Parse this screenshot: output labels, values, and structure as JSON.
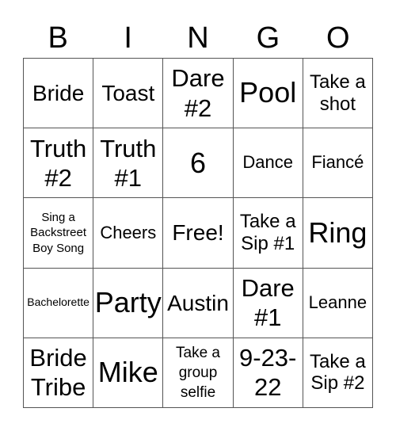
{
  "header": {
    "letters": [
      "B",
      "I",
      "N",
      "G",
      "O"
    ]
  },
  "grid": {
    "rows": [
      [
        "Bride",
        "Toast",
        "Dare #2",
        "Pool",
        "Take a shot"
      ],
      [
        "Truth #2",
        "Truth #1",
        "6",
        "Dance",
        "Fiancé"
      ],
      [
        "Sing a Backstreet Boy Song",
        "Cheers",
        "Free!",
        "Take a Sip #1",
        "Ring"
      ],
      [
        "Bachelorette",
        "Party",
        "Austin",
        "Dare #1",
        "Leanne"
      ],
      [
        "Bride Tribe",
        "Mike",
        "Take a group selfie",
        "9-23-22",
        "Take a Sip #2"
      ]
    ]
  }
}
